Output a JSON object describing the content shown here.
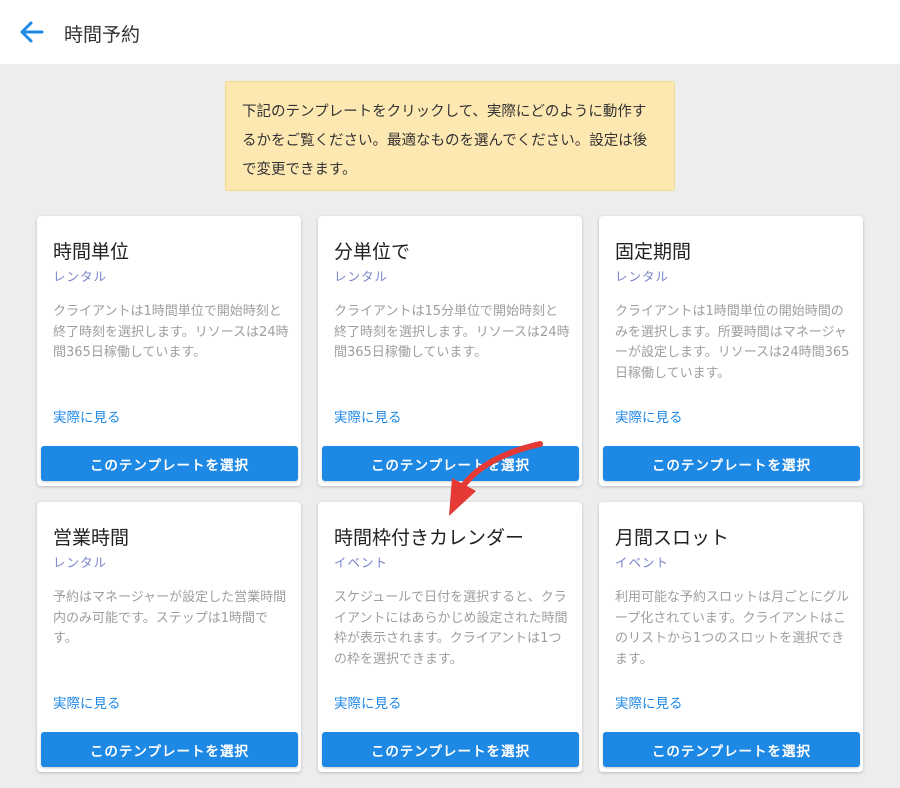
{
  "header": {
    "title": "時間予約",
    "back_icon": "arrow-left-icon"
  },
  "notice": {
    "text": "下記のテンプレートをクリックして、実際にどのように動作するかをご覧ください。最適なものを選んでください。設定は後で変更できます。"
  },
  "cards": [
    {
      "title": "時間単位",
      "subtitle": "レンタル",
      "description": "クライアントは1時間単位で開始時刻と終了時刻を選択します。リソースは24時間365日稼働しています。",
      "link": "実際に見る",
      "button": "このテンプレートを選択"
    },
    {
      "title": "分単位で",
      "subtitle": "レンタル",
      "description": "クライアントは15分単位で開始時刻と終了時刻を選択します。リソースは24時間365日稼働しています。",
      "link": "実際に見る",
      "button": "このテンプレートを選択"
    },
    {
      "title": "固定期間",
      "subtitle": "レンタル",
      "description": "クライアントは1時間単位の開始時間のみを選択します。所要時間はマネージャーが設定します。リソースは24時間365日稼働しています。",
      "link": "実際に見る",
      "button": "このテンプレートを選択"
    },
    {
      "title": "営業時間",
      "subtitle": "レンタル",
      "description": "予約はマネージャーが設定した営業時間内のみ可能です。ステップは1時間です。",
      "link": "実際に見る",
      "button": "このテンプレートを選択"
    },
    {
      "title": "時間枠付きカレンダー",
      "subtitle": "イベント",
      "description": "スケジュールで日付を選択すると、クライアントにはあらかじめ設定された時間枠が表示されます。クライアントは1つの枠を選択できます。",
      "link": "実際に見る",
      "button": "このテンプレートを選択"
    },
    {
      "title": "月間スロット",
      "subtitle": "イベント",
      "description": "利用可能な予約スロットは月ごとにグループ化されています。クライアントはこのリストから1つのスロットを選択できます。",
      "link": "実際に見る",
      "button": "このテンプレートを選択"
    }
  ],
  "colors": {
    "accent": "#1e88e5",
    "subtitle": "#7986cb",
    "notice_bg": "#fde8b2",
    "annotation_arrow": "#e53935"
  },
  "annotation": {
    "icon": "curved-arrow-icon"
  }
}
